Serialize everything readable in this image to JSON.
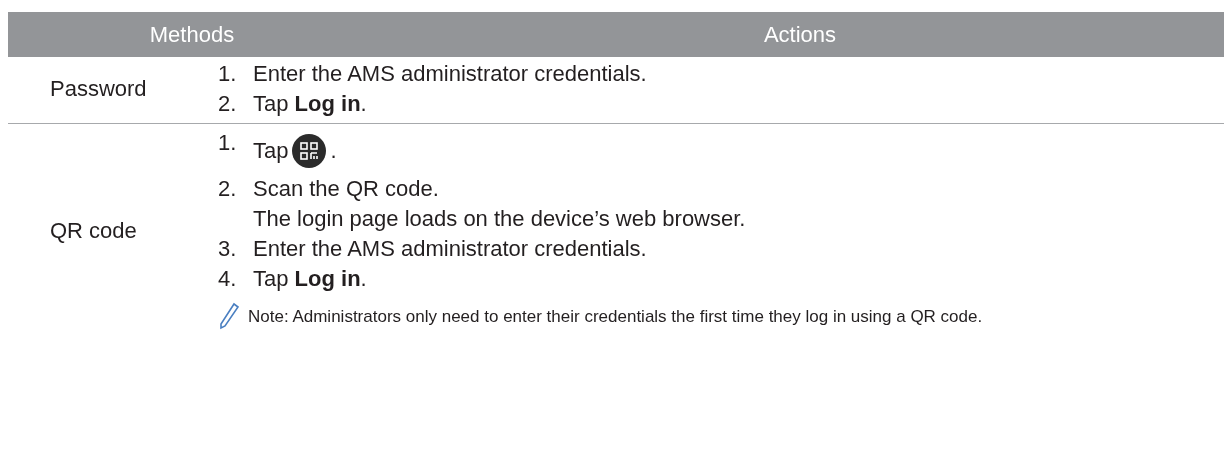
{
  "table": {
    "columns": [
      "Methods",
      "Actions"
    ],
    "rows": [
      {
        "method": "Password",
        "steps": [
          {
            "kind": "text",
            "number": "1.",
            "text": "Enter the AMS administrator credentials."
          },
          {
            "kind": "text",
            "number": "2.",
            "text": "Tap **Log in**."
          }
        ]
      },
      {
        "method": "QR code",
        "steps": [
          {
            "kind": "icon",
            "number": "1.",
            "text": "Tap",
            "after": "."
          },
          {
            "kind": "text",
            "number": "2.",
            "text": "Scan the QR code.",
            "detail": "The login page loads on the device’s web browser."
          },
          {
            "kind": "text",
            "number": "3.",
            "text": "Enter the AMS administrator credentials."
          },
          {
            "kind": "text",
            "number": "4.",
            "text": "Tap **Log in**."
          }
        ],
        "note": "Note: Administrators only need to enter their credentials the first time they log in using a QR code."
      }
    ]
  }
}
